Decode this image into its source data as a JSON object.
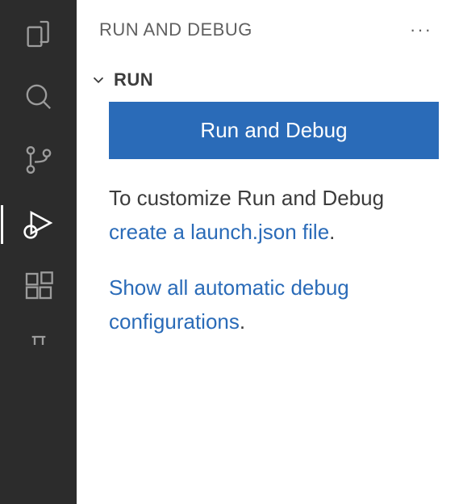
{
  "sidebar": {
    "title": "RUN AND DEBUG",
    "more_label": "···",
    "section_title": "RUN"
  },
  "content": {
    "run_button": "Run and Debug",
    "customize_prefix": "To customize Run and Debug ",
    "create_launch_link": "create a launch.json file",
    "show_all_link": "Show all automatic debug configurations",
    "period": "."
  }
}
